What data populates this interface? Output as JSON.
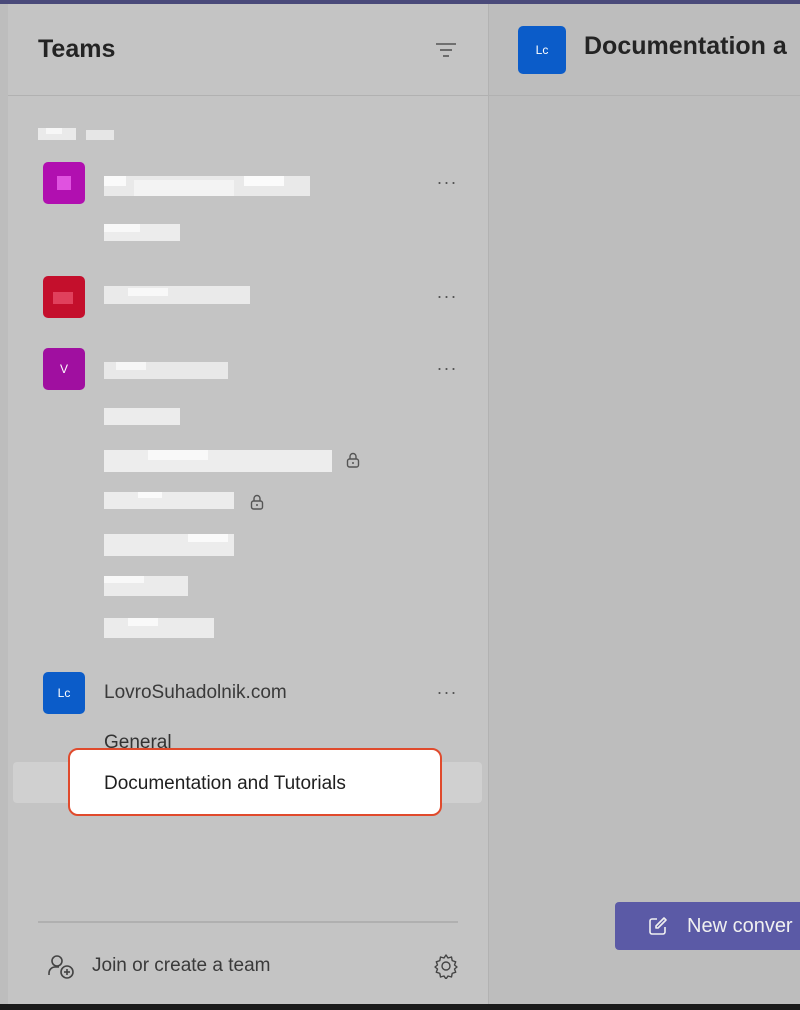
{
  "sidebar": {
    "title": "Teams",
    "teams": [
      {
        "avatar_color": "#b10fb0",
        "avatar_text": ""
      },
      {
        "avatar_color": "#c40f2c",
        "avatar_text": ""
      },
      {
        "avatar_color": "#a00fa0",
        "avatar_text": "V"
      },
      {
        "avatar_color": "#0b5cc9",
        "avatar_text": "Lc",
        "name": "LovroSuhadolnik.com",
        "channels": [
          "General",
          "Documentation and Tutorials"
        ]
      }
    ],
    "join_label": "Join or create a team"
  },
  "main": {
    "avatar_text": "Lc",
    "title": "Documentation a",
    "new_conversation_label": "New conver"
  },
  "colors": {
    "accent": "#5b5aa6",
    "highlight_border": "#e04a2c",
    "team_blue": "#0b5cc9"
  },
  "icons": {
    "filter": "filter-icon",
    "more": "more-icon",
    "lock": "lock-icon",
    "join": "people-add-icon",
    "settings": "gear-icon",
    "compose": "compose-icon"
  }
}
